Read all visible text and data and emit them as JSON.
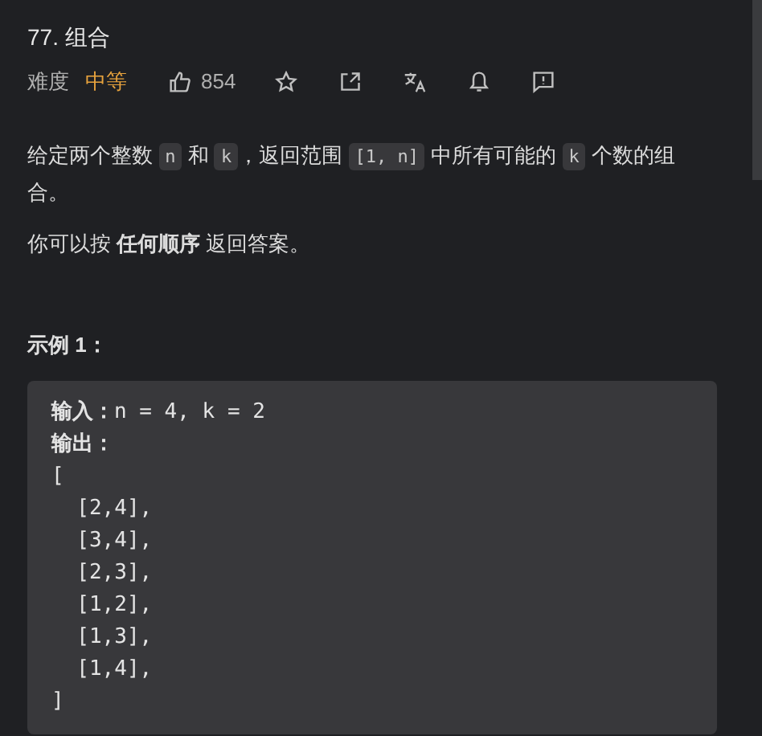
{
  "title": "77. 组合",
  "meta": {
    "difficulty_label": "难度",
    "difficulty": "中等",
    "likes": "854"
  },
  "description": [
    {
      "kind": "segments",
      "segments": [
        {
          "kind": "text",
          "text": "给定两个整数 "
        },
        {
          "kind": "code",
          "text": "n"
        },
        {
          "kind": "text",
          "text": " 和 "
        },
        {
          "kind": "code",
          "text": "k"
        },
        {
          "kind": "text",
          "text": "，返回范围 "
        },
        {
          "kind": "code",
          "text": "[1, n]"
        },
        {
          "kind": "text",
          "text": " 中所有可能的 "
        },
        {
          "kind": "code",
          "text": "k"
        },
        {
          "kind": "text",
          "text": " 个数的组合。"
        }
      ]
    },
    {
      "kind": "rich",
      "text": "你可以按 **任何顺序** 返回答案。"
    }
  ],
  "example": {
    "heading": "示例 1：",
    "lines": [
      "**输入：**n = 4, k = 2",
      "**输出：**",
      "[",
      "  [2,4],",
      "  [3,4],",
      "  [2,3],",
      "  [1,2],",
      "  [1,3],",
      "  [1,4],",
      "]"
    ]
  }
}
